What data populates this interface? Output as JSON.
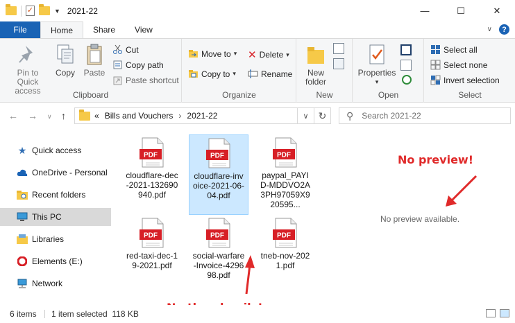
{
  "window": {
    "title": "2021-22",
    "controls": [
      "—",
      "☐",
      "✕"
    ]
  },
  "tabs": [
    "File",
    "Home",
    "Share",
    "View"
  ],
  "ribbon": {
    "clipboard": {
      "label": "Clipboard",
      "pin": "Pin to Quick access",
      "copy": "Copy",
      "paste": "Paste",
      "cut": "Cut",
      "copy_path": "Copy path",
      "paste_shortcut": "Paste shortcut"
    },
    "organize": {
      "label": "Organize",
      "move_to": "Move to",
      "copy_to": "Copy to",
      "delete": "Delete",
      "rename": "Rename"
    },
    "new": {
      "label": "New",
      "new_folder": "New folder"
    },
    "open": {
      "label": "Open",
      "properties": "Properties"
    },
    "select": {
      "label": "Select",
      "select_all": "Select all",
      "select_none": "Select none",
      "invert": "Invert selection"
    }
  },
  "address": {
    "overflow": "«",
    "crumbs": [
      "Bills and Vouchers",
      "2021-22"
    ]
  },
  "search": {
    "placeholder": "Search 2021-22"
  },
  "navpane": [
    {
      "label": "Quick access",
      "icon": "star-icon"
    },
    {
      "label": "OneDrive - Personal",
      "icon": "cloud-icon"
    },
    {
      "label": "Recent folders",
      "icon": "recent-folder-icon"
    },
    {
      "label": "This PC",
      "icon": "computer-icon"
    },
    {
      "label": "Libraries",
      "icon": "libraries-icon"
    },
    {
      "label": "Elements (E:)",
      "icon": "drive-icon"
    },
    {
      "label": "Network",
      "icon": "network-icon"
    }
  ],
  "files": [
    {
      "name": "cloudflare-dec-2021-132690940.pdf",
      "badge": "PDF",
      "selected": false
    },
    {
      "name": "cloudflare-invoice-2021-06-04.pdf",
      "badge": "PDF",
      "selected": true
    },
    {
      "name": "paypal_PAYID-MDDVO2A3PH97059X920595...",
      "badge": "PDF",
      "selected": false
    },
    {
      "name": "red-taxi-dec-19-2021.pdf",
      "badge": "PDF",
      "selected": false
    },
    {
      "name": "social-warfare-Invoice-429698.pdf",
      "badge": "PDF",
      "selected": false
    },
    {
      "name": "tneb-nov-2021.pdf",
      "badge": "PDF",
      "selected": false
    }
  ],
  "preview": {
    "message": "No preview available."
  },
  "annotations": {
    "no_preview": "No preview!",
    "no_thumbnails": "No thumbnails!",
    "color": "#e02a2a"
  },
  "status": {
    "items": "6 items",
    "selected": "1 item selected  118 KB"
  },
  "colors": {
    "accent": "#1a63b5",
    "selection": "#cce8ff",
    "pdf_red": "#d71f26"
  }
}
